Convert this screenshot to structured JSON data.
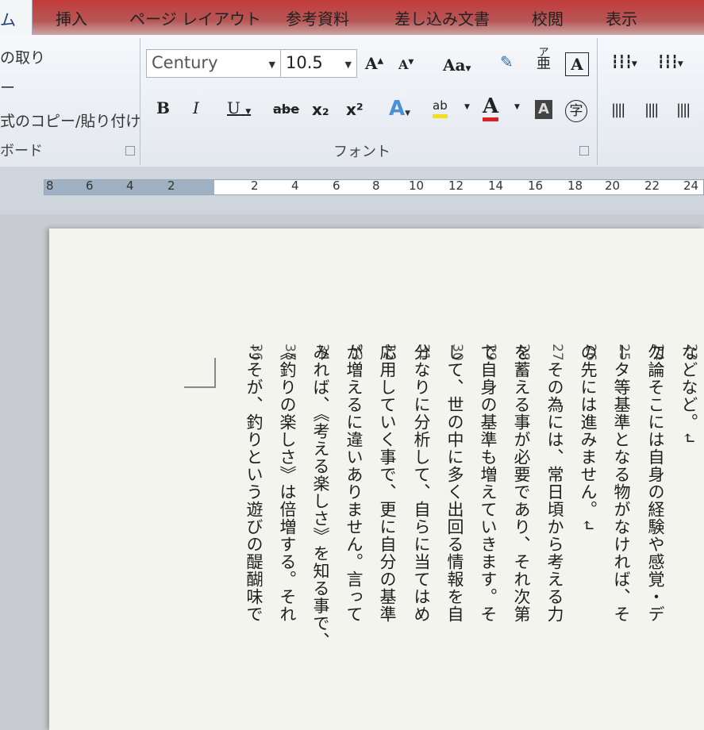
{
  "tabs": {
    "home": "ム",
    "insert": "挿入",
    "layout": "ページ レイアウト",
    "references": "参考資料",
    "mailings": "差し込み文書",
    "review": "校閲",
    "view": "表示"
  },
  "clipboard": {
    "cut": "の取り",
    "copy_dash": "ー",
    "format_painter": "式のコピー/貼り付け",
    "group_label": "ボード"
  },
  "font": {
    "name": "Century",
    "size": "10.5",
    "group_label": "フォント",
    "grow": "A",
    "shrink": "A",
    "case": "Aa",
    "bold": "B",
    "italic": "I",
    "underline": "U",
    "strike": "abe",
    "subscript": "x₂",
    "superscript": "x²",
    "highlight": "ab",
    "font_color": "A",
    "char_shade": "A",
    "enclose": "字",
    "phonetic_top": "ア",
    "phonetic_bottom": "亜",
    "char_border": "A"
  },
  "ruler_numbers": [
    "8",
    "6",
    "4",
    "2",
    "2",
    "4",
    "6",
    "8",
    "10",
    "12",
    "14",
    "16",
    "18",
    "20",
    "22",
    "24"
  ],
  "lines": [
    {
      "num": "23",
      "text": "などなど。↵"
    },
    {
      "num": "24",
      "text": "勿論そこには自身の経験や感覚・デ"
    },
    {
      "num": "25",
      "text": "ータ等基準となる物がなければ、そ"
    },
    {
      "num": "26",
      "text": "の先には進みません。↵"
    },
    {
      "num": "27",
      "text": "　その為には、常日頃から考える力"
    },
    {
      "num": "28",
      "text": "を蓄える事が必要であり、それ次第"
    },
    {
      "num": "29",
      "text": "で自身の基準も増えていきます。そ"
    },
    {
      "num": "30",
      "text": "して、世の中に多く出回る情報を自"
    },
    {
      "num": "31",
      "text": "分なりに分析して、自らに当てはめ"
    },
    {
      "num": "32",
      "text": "応用していく事で、更に自分の基準"
    },
    {
      "num": "33",
      "text": "が増えるに違いありません。言って"
    },
    {
      "num": "34",
      "text": "みれば、《考える楽しさ》を知る事で、"
    },
    {
      "num": "35",
      "text": "《釣りの楽しさ》は倍増する。それ"
    },
    {
      "num": "36",
      "text": "こそが、釣りという遊びの醍醐味で"
    }
  ]
}
